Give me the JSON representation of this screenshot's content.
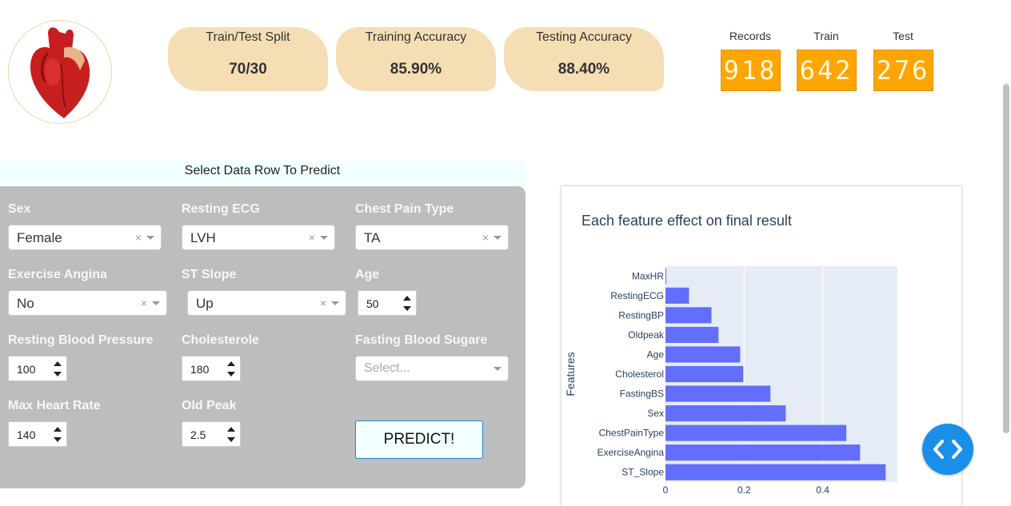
{
  "logo": {
    "icon": "heart-icon"
  },
  "stats": [
    {
      "title": "Train/Test Split",
      "value": "70/30"
    },
    {
      "title": "Training Accuracy",
      "value": "85.90%"
    },
    {
      "title": "Testing Accuracy",
      "value": "88.40%"
    }
  ],
  "counters": [
    {
      "label": "Records",
      "value": "918"
    },
    {
      "label": "Train",
      "value": "642"
    },
    {
      "label": "Test",
      "value": "276"
    }
  ],
  "form": {
    "header": "Select Data Row To Predict",
    "sex": {
      "label": "Sex",
      "value": "Female"
    },
    "resting_ecg": {
      "label": "Resting ECG",
      "value": "LVH"
    },
    "chest_pain": {
      "label": "Chest Pain Type",
      "value": "TA"
    },
    "exercise_angina": {
      "label": "Exercise Angina",
      "value": "No"
    },
    "st_slope": {
      "label": "ST Slope",
      "value": "Up"
    },
    "age": {
      "label": "Age",
      "value": "50"
    },
    "resting_bp": {
      "label": "Resting Blood Pressure",
      "value": "100"
    },
    "cholesterol": {
      "label": "Cholesterole",
      "value": "180"
    },
    "fasting_bs": {
      "label": "Fasting Blood Sugare",
      "placeholder": "Select..."
    },
    "max_hr": {
      "label": "Max Heart Rate",
      "value": "140"
    },
    "old_peak": {
      "label": "Old Peak",
      "value": "2.5"
    },
    "clear_symbol": "×",
    "predict_label": "PREDICT!"
  },
  "chart_data": {
    "type": "bar",
    "orientation": "horizontal",
    "title": "Each feature effect on final result",
    "ylabel": "Features",
    "xlabel": "",
    "categories": [
      "MaxHR",
      "RestingECG",
      "RestingBP",
      "Oldpeak",
      "Age",
      "Cholesterol",
      "FastingBS",
      "Sex",
      "ChestPainType",
      "ExerciseAngina",
      "ST_Slope"
    ],
    "values": [
      0.0,
      0.06,
      0.117,
      0.135,
      0.19,
      0.198,
      0.267,
      0.306,
      0.46,
      0.495,
      0.56
    ],
    "xlim": [
      0,
      0.59
    ],
    "xticks": [
      0,
      0.2,
      0.4
    ],
    "xtick_labels": [
      "0",
      "0.2",
      "0.4"
    ],
    "bar_color": "#636efa",
    "plot_bg": "#e5ecf6",
    "grid": true
  },
  "colors": {
    "card": "#f5deb3",
    "led": "#ffa500",
    "panel": "#bdbdbd",
    "fab": "#1a8fe8"
  },
  "fab": {
    "icon": "code-icon"
  }
}
